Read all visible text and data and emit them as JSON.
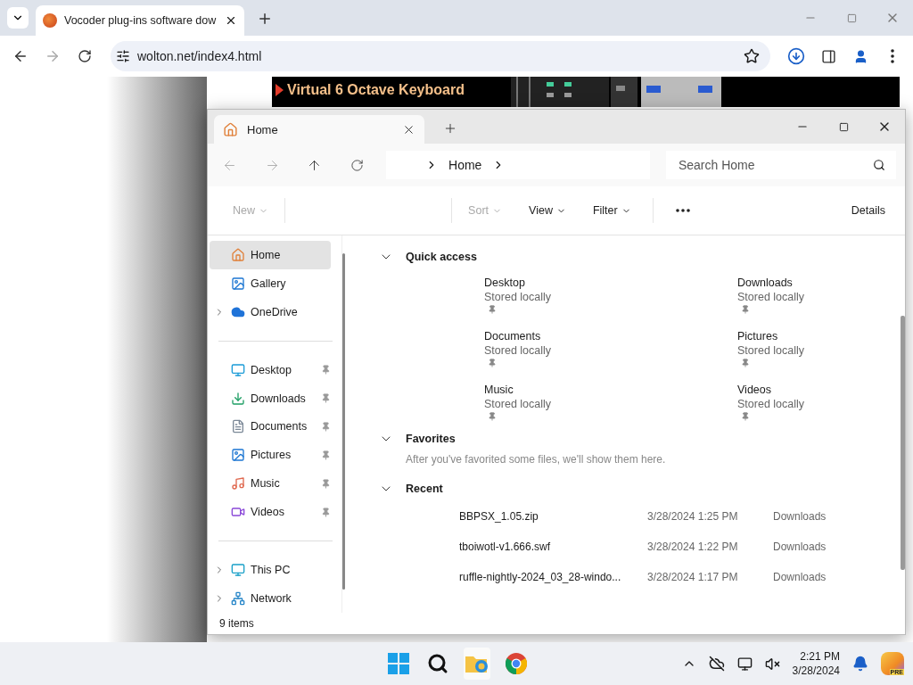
{
  "browser": {
    "tabs": [
      {
        "title": "Vocoder plug-ins software dow",
        "selected": true
      }
    ],
    "url": "wolton.net/index4.html"
  },
  "web_page": {
    "banner_lines": [
      "Virtual 6 Octave Keyboard"
    ]
  },
  "explorer": {
    "tabs": [
      {
        "label": "Home",
        "selected": true
      }
    ],
    "breadcrumb": [
      "Home"
    ],
    "search": {
      "placeholder": "Search Home"
    },
    "commands": [
      {
        "label": "New",
        "disabled": true
      },
      {
        "label": "Sort",
        "disabled": true
      },
      {
        "label": "View",
        "disabled": false
      },
      {
        "label": "Filter",
        "disabled": false
      }
    ],
    "details_button": "Details",
    "sidebar_groups": [
      [
        {
          "label": "Home",
          "selected": true,
          "expandable": false,
          "pinned": false
        },
        {
          "label": "Gallery",
          "selected": false,
          "expandable": false,
          "pinned": false
        },
        {
          "label": "OneDrive",
          "selected": false,
          "expandable": true,
          "pinned": false
        }
      ],
      [
        {
          "label": "Desktop",
          "selected": false,
          "expandable": false,
          "pinned": true
        },
        {
          "label": "Downloads",
          "selected": false,
          "expandable": false,
          "pinned": true
        },
        {
          "label": "Documents",
          "selected": false,
          "expandable": false,
          "pinned": true
        },
        {
          "label": "Pictures",
          "selected": false,
          "expandable": false,
          "pinned": true
        },
        {
          "label": "Music",
          "selected": false,
          "expandable": false,
          "pinned": true
        },
        {
          "label": "Videos",
          "selected": false,
          "expandable": false,
          "pinned": true
        }
      ],
      [
        {
          "label": "This PC",
          "selected": false,
          "expandable": true,
          "pinned": false
        },
        {
          "label": "Network",
          "selected": false,
          "expandable": true,
          "pinned": false
        }
      ]
    ],
    "quick_access": {
      "title": "Quick access",
      "expanded": true,
      "items": [
        {
          "name": "Desktop",
          "status": "Stored locally",
          "pinned": true
        },
        {
          "name": "Downloads",
          "status": "Stored locally",
          "pinned": true
        },
        {
          "name": "Documents",
          "status": "Stored locally",
          "pinned": true
        },
        {
          "name": "Pictures",
          "status": "Stored locally",
          "pinned": true
        },
        {
          "name": "Music",
          "status": "Stored locally",
          "pinned": true
        },
        {
          "name": "Videos",
          "status": "Stored locally",
          "pinned": true
        }
      ]
    },
    "favorites": {
      "title": "Favorites",
      "expanded": true,
      "message": "After you've favorited some files, we'll show them here."
    },
    "recent": {
      "title": "Recent",
      "expanded": true,
      "rows": [
        {
          "name": "BBPSX_1.05.zip",
          "date": "3/28/2024 1:25 PM",
          "location": "Downloads"
        },
        {
          "name": "tboiwotl-v1.666.swf",
          "date": "3/28/2024 1:22 PM",
          "location": "Downloads"
        },
        {
          "name": "ruffle-nightly-2024_03_28-windo...",
          "date": "3/28/2024 1:17 PM",
          "location": "Downloads"
        }
      ]
    },
    "status_bar": "9 items"
  },
  "taskbar": {
    "copilot_badge": "PRE",
    "time": "2:21 PM",
    "date": "3/28/2024"
  }
}
